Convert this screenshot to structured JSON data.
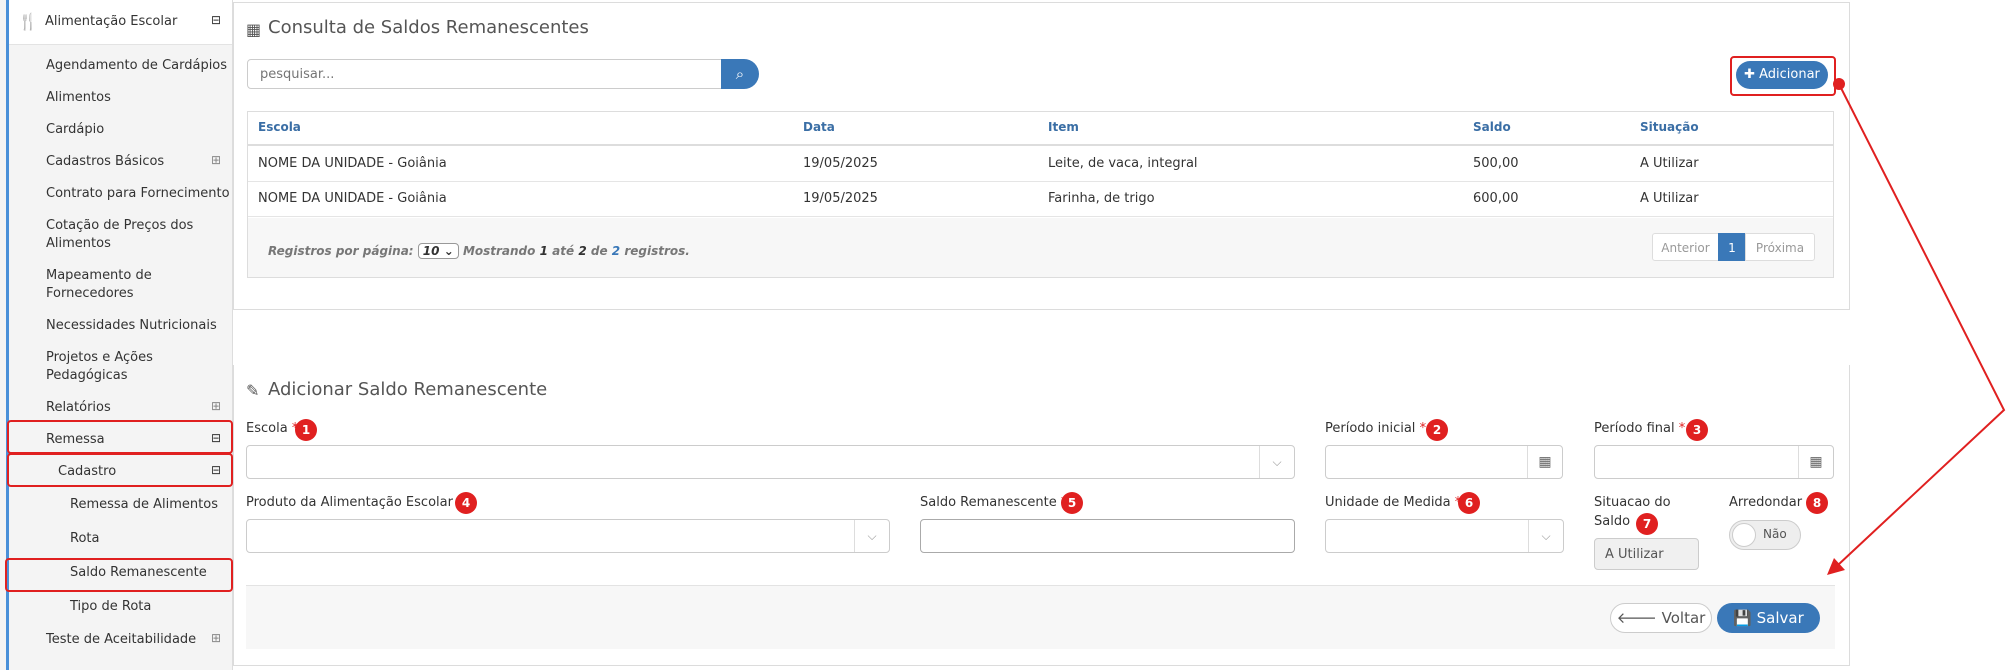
{
  "sidebar": {
    "module": "Alimentação Escolar",
    "module_sign": "⊟",
    "items": [
      {
        "label": "Agendamento de Cardápios"
      },
      {
        "label": "Alimentos"
      },
      {
        "label": "Cardápio"
      },
      {
        "label": "Cadastros Básicos",
        "sign": "⊞"
      },
      {
        "label": "Contrato para Fornecimento"
      },
      {
        "label": "Cotação de Preços dos",
        "label2": "Alimentos"
      },
      {
        "label": "Mapeamento de",
        "label2": "Fornecedores"
      },
      {
        "label": "Necessidades Nutricionais"
      },
      {
        "label": "Projetos e Ações",
        "label2": "Pedagógicas"
      },
      {
        "label": "Relatórios",
        "sign": "⊞"
      },
      {
        "label": "Remessa",
        "sign": "⊟"
      },
      {
        "label": "Cadastro",
        "sign": "⊟"
      },
      {
        "label": "Remessa de Alimentos"
      },
      {
        "label": "Rota"
      },
      {
        "label": "Saldo Remanescente"
      },
      {
        "label": "Tipo de Rota"
      },
      {
        "label": "Teste de Aceitabilidade",
        "sign": "⊞"
      }
    ]
  },
  "consulta": {
    "title": "Consulta de Saldos Remanescentes",
    "search_placeholder": "pesquisar...",
    "add_label": "✚ Adicionar",
    "columns": [
      "Escola",
      "Data",
      "Item",
      "Saldo",
      "Situação"
    ],
    "rows": [
      [
        "NOME DA UNIDADE - Goiânia",
        "19/05/2025",
        "Leite, de vaca, integral",
        "500,00",
        "A Utilizar"
      ],
      [
        "NOME DA UNIDADE - Goiânia",
        "19/05/2025",
        "Farinha, de trigo",
        "600,00",
        "A Utilizar"
      ]
    ],
    "per_page_label": "Registros por página:",
    "per_page_value": "10",
    "showing": "Mostrando",
    "from": "1",
    "ate": "até",
    "to": "2",
    "de": "de",
    "total": "2",
    "registros": "registros.",
    "prev": "Anterior",
    "page": "1",
    "next": "Próxima"
  },
  "form": {
    "title": "Adicionar Saldo Remanescente",
    "escola": "Escola",
    "periodo_inicial": "Período inicial",
    "periodo_final": "Período final",
    "produto": "Produto da Alimentação Escolar",
    "saldo": "Saldo Remanescente",
    "unidade": "Unidade de Medida",
    "situacao_1": "Situacao do",
    "situacao_2": "Saldo",
    "situacao_value": "A Utilizar",
    "arredondar": "Arredondar",
    "toggle_value": "Não",
    "req": "*",
    "voltar": "🡐 Voltar",
    "salvar": "💾 Salvar",
    "badges": [
      "1",
      "2",
      "3",
      "4",
      "5",
      "6",
      "7",
      "8"
    ]
  },
  "colors": {
    "accent": "#3a78b8",
    "annotation": "#e02020"
  }
}
